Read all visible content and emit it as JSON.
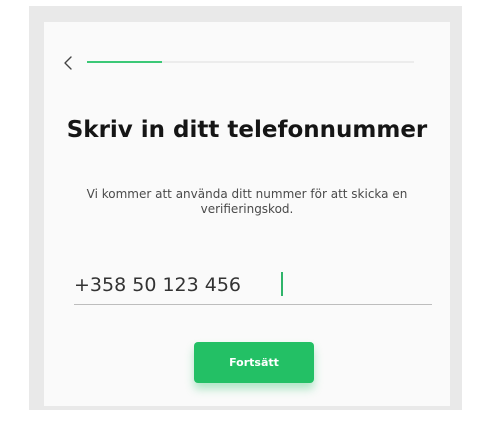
{
  "colors": {
    "accent": "#23c065",
    "progress_track": "#ececec",
    "frame_background": "#e9e9e9"
  },
  "header": {
    "back_icon": "chevron-left-icon",
    "progress": 0.23
  },
  "main": {
    "title": "Skriv in ditt telefonnummer",
    "subtitle": "Vi kommer att använda ditt nummer för att skicka en verifieringskod.",
    "phone": {
      "value": "+358 50 123 456"
    },
    "continue_label": "Fortsätt"
  }
}
